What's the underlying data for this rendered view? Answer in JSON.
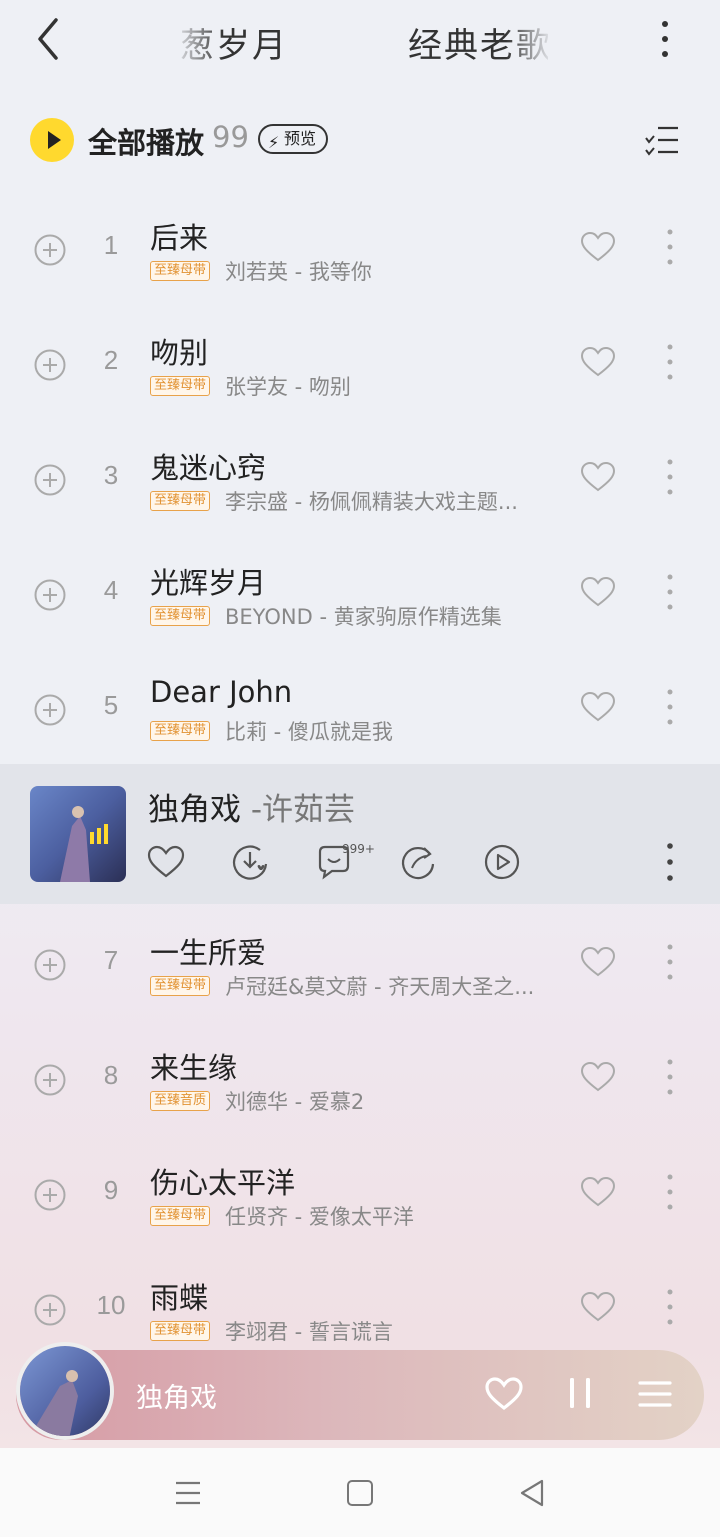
{
  "header": {
    "tab_left": "葱岁月",
    "tab_right": "经典老歌"
  },
  "playall": {
    "label": "全部播放",
    "count": "99",
    "preview_badge": "预览"
  },
  "songs": [
    {
      "index": "1",
      "title": "后来",
      "quality": "至臻母带",
      "meta": "刘若英 - 我等你"
    },
    {
      "index": "2",
      "title": "吻别",
      "quality": "至臻母带",
      "meta": "张学友 - 吻别"
    },
    {
      "index": "3",
      "title": "鬼迷心窍",
      "quality": "至臻母带",
      "meta": "李宗盛 - 杨佩佩精装大戏主题..."
    },
    {
      "index": "4",
      "title": "光辉岁月",
      "quality": "至臻母带",
      "meta": "BEYOND - 黄家驹原作精选集"
    },
    {
      "index": "5",
      "title": "Dear John",
      "quality": "至臻母带",
      "meta": "比莉 - 傻瓜就是我"
    },
    {
      "index": "7",
      "title": "一生所爱",
      "quality": "至臻母带",
      "meta": "卢冠廷&莫文蔚 - 齐天周大圣之..."
    },
    {
      "index": "8",
      "title": "来生缘",
      "quality": "至臻音质",
      "meta": "刘德华 - 爱慕2"
    },
    {
      "index": "9",
      "title": "伤心太平洋",
      "quality": "至臻母带",
      "meta": "任贤齐 - 爱像太平洋"
    },
    {
      "index": "10",
      "title": "雨蝶",
      "quality": "至臻母带",
      "meta": "李翊君 - 誓言谎言"
    }
  ],
  "now_playing_row": {
    "title": "独角戏",
    "artist": "-许茹芸",
    "comment_count": "999+"
  },
  "mini_player": {
    "title": "独角戏"
  },
  "colors": {
    "accent_yellow": "#ffd92e",
    "quality_orange": "#e29334",
    "mini_player_gradient_start": "#d69aa4",
    "mini_player_gradient_end": "#e3d2c6"
  }
}
